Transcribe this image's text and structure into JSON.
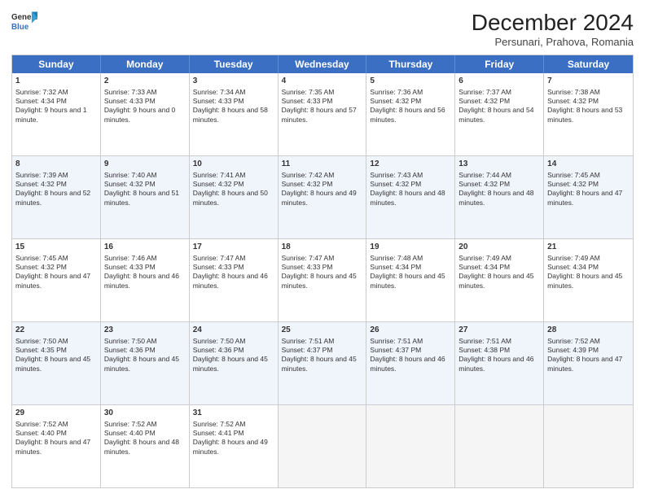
{
  "logo": {
    "line1": "General",
    "line2": "Blue"
  },
  "title": "December 2024",
  "location": "Persunari, Prahova, Romania",
  "days": [
    "Sunday",
    "Monday",
    "Tuesday",
    "Wednesday",
    "Thursday",
    "Friday",
    "Saturday"
  ],
  "weeks": [
    [
      {
        "day": "1",
        "sunrise": "7:32 AM",
        "sunset": "4:34 PM",
        "daylight": "9 hours and 1 minute."
      },
      {
        "day": "2",
        "sunrise": "7:33 AM",
        "sunset": "4:33 PM",
        "daylight": "9 hours and 0 minutes."
      },
      {
        "day": "3",
        "sunrise": "7:34 AM",
        "sunset": "4:33 PM",
        "daylight": "8 hours and 58 minutes."
      },
      {
        "day": "4",
        "sunrise": "7:35 AM",
        "sunset": "4:33 PM",
        "daylight": "8 hours and 57 minutes."
      },
      {
        "day": "5",
        "sunrise": "7:36 AM",
        "sunset": "4:32 PM",
        "daylight": "8 hours and 56 minutes."
      },
      {
        "day": "6",
        "sunrise": "7:37 AM",
        "sunset": "4:32 PM",
        "daylight": "8 hours and 54 minutes."
      },
      {
        "day": "7",
        "sunrise": "7:38 AM",
        "sunset": "4:32 PM",
        "daylight": "8 hours and 53 minutes."
      }
    ],
    [
      {
        "day": "8",
        "sunrise": "7:39 AM",
        "sunset": "4:32 PM",
        "daylight": "8 hours and 52 minutes."
      },
      {
        "day": "9",
        "sunrise": "7:40 AM",
        "sunset": "4:32 PM",
        "daylight": "8 hours and 51 minutes."
      },
      {
        "day": "10",
        "sunrise": "7:41 AM",
        "sunset": "4:32 PM",
        "daylight": "8 hours and 50 minutes."
      },
      {
        "day": "11",
        "sunrise": "7:42 AM",
        "sunset": "4:32 PM",
        "daylight": "8 hours and 49 minutes."
      },
      {
        "day": "12",
        "sunrise": "7:43 AM",
        "sunset": "4:32 PM",
        "daylight": "8 hours and 48 minutes."
      },
      {
        "day": "13",
        "sunrise": "7:44 AM",
        "sunset": "4:32 PM",
        "daylight": "8 hours and 48 minutes."
      },
      {
        "day": "14",
        "sunrise": "7:45 AM",
        "sunset": "4:32 PM",
        "daylight": "8 hours and 47 minutes."
      }
    ],
    [
      {
        "day": "15",
        "sunrise": "7:45 AM",
        "sunset": "4:32 PM",
        "daylight": "8 hours and 47 minutes."
      },
      {
        "day": "16",
        "sunrise": "7:46 AM",
        "sunset": "4:33 PM",
        "daylight": "8 hours and 46 minutes."
      },
      {
        "day": "17",
        "sunrise": "7:47 AM",
        "sunset": "4:33 PM",
        "daylight": "8 hours and 46 minutes."
      },
      {
        "day": "18",
        "sunrise": "7:47 AM",
        "sunset": "4:33 PM",
        "daylight": "8 hours and 45 minutes."
      },
      {
        "day": "19",
        "sunrise": "7:48 AM",
        "sunset": "4:34 PM",
        "daylight": "8 hours and 45 minutes."
      },
      {
        "day": "20",
        "sunrise": "7:49 AM",
        "sunset": "4:34 PM",
        "daylight": "8 hours and 45 minutes."
      },
      {
        "day": "21",
        "sunrise": "7:49 AM",
        "sunset": "4:34 PM",
        "daylight": "8 hours and 45 minutes."
      }
    ],
    [
      {
        "day": "22",
        "sunrise": "7:50 AM",
        "sunset": "4:35 PM",
        "daylight": "8 hours and 45 minutes."
      },
      {
        "day": "23",
        "sunrise": "7:50 AM",
        "sunset": "4:36 PM",
        "daylight": "8 hours and 45 minutes."
      },
      {
        "day": "24",
        "sunrise": "7:50 AM",
        "sunset": "4:36 PM",
        "daylight": "8 hours and 45 minutes."
      },
      {
        "day": "25",
        "sunrise": "7:51 AM",
        "sunset": "4:37 PM",
        "daylight": "8 hours and 45 minutes."
      },
      {
        "day": "26",
        "sunrise": "7:51 AM",
        "sunset": "4:37 PM",
        "daylight": "8 hours and 46 minutes."
      },
      {
        "day": "27",
        "sunrise": "7:51 AM",
        "sunset": "4:38 PM",
        "daylight": "8 hours and 46 minutes."
      },
      {
        "day": "28",
        "sunrise": "7:52 AM",
        "sunset": "4:39 PM",
        "daylight": "8 hours and 47 minutes."
      }
    ],
    [
      {
        "day": "29",
        "sunrise": "7:52 AM",
        "sunset": "4:40 PM",
        "daylight": "8 hours and 47 minutes."
      },
      {
        "day": "30",
        "sunrise": "7:52 AM",
        "sunset": "4:40 PM",
        "daylight": "8 hours and 48 minutes."
      },
      {
        "day": "31",
        "sunrise": "7:52 AM",
        "sunset": "4:41 PM",
        "daylight": "8 hours and 49 minutes."
      },
      null,
      null,
      null,
      null
    ]
  ]
}
